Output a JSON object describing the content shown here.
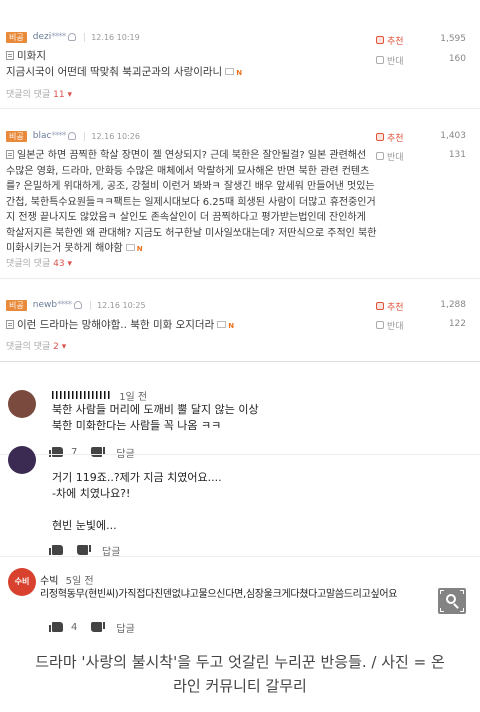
{
  "board": {
    "comments": [
      {
        "badge": "비공",
        "user": "dezi",
        "stars": "****",
        "time": "12.16 10:19",
        "text_lines": [
          "미화지",
          "지금시국이 어떤데 딱맞춰 북괴군과의 사랑이라니"
        ],
        "replies_label": "댓글의 댓글",
        "replies_count": "11",
        "up_label": "추천",
        "up_count": "1,595",
        "down_label": "반대",
        "down_count": "160"
      },
      {
        "badge": "비공",
        "user": "blac",
        "stars": "****",
        "time": "12.16 10:26",
        "text_lines": [
          "일본군 하면 끔찍한 학살 장면이 젤 연상되지? 근데 북한은 잘안될걸? 일본 관련해선",
          "수많은 영화, 드라마, 만화등 수많은 매체에서 악랄하게 묘사해온 반면 북한 관련 컨텐츠",
          "를? 은밀하게 위대하게, 공조, 강철비 이런거 봐봐ㅋ 잘생긴 배우 앞세워 만들어낸 멋있는",
          "간첩, 북한특수요원들ㅋㅋ팩트는 일제시대보다 6.25때 희생된 사람이 더많고 휴전중인거",
          "지 전쟁 끝나지도 않았음ㅋ 살인도 존속살인이 더 끔찍하다고 평가받는법인데 잔인하게",
          "학살저지른 북한엔 왜 관대해? 지금도 허구한날 미사일쏘대는데? 저딴식으로 주적인 북한",
          "미화시키는거 못하게 해야함"
        ],
        "replies_label": "댓글의 댓글",
        "replies_count": "43",
        "up_label": "추천",
        "up_count": "1,403",
        "down_label": "반대",
        "down_count": "131"
      },
      {
        "badge": "비공",
        "user": "newb",
        "stars": "****",
        "time": "12.16 10:25",
        "text_lines": [
          "이런 드라마는 망해야함.. 북한 미화 오지더라"
        ],
        "replies_label": "댓글의 댓글",
        "replies_count": "2",
        "up_label": "추천",
        "up_count": "1,288",
        "down_label": "반대",
        "down_count": "122"
      }
    ]
  },
  "community": {
    "comments": [
      {
        "avatar_color": "#7a4a3e",
        "avatar_text": "",
        "user": "",
        "time": "1일 전",
        "text_lines": [
          "북한 사람들 머리에 도깨비 뿔 달지 않는 이상",
          "북한 미화한다는 사람들 꼭 나옴 ㅋㅋ"
        ],
        "likes": "7",
        "reply_label": "답글"
      },
      {
        "avatar_color": "#3b2a52",
        "avatar_text": "",
        "user": "",
        "time": "",
        "text_lines": [
          "거기 119죠..?제가 지금 치였어요....",
          "-차에 치였나요?!",
          "",
          "현빈 눈빛에..."
        ],
        "likes": "",
        "reply_label": "답글"
      },
      {
        "avatar_color": "#d8412d",
        "avatar_text": "수비",
        "user": "수빅",
        "time": "5일 전",
        "text_lines": [
          "리정혁동무(현빈씨)가직접다친덴없냐고물으신다면,심장울크게다쳤다고말씀드리고싶어요"
        ],
        "likes": "4",
        "reply_label": "답글"
      }
    ]
  },
  "caption": {
    "line1": "드라마 '사랑의 불시착'을 두고 엇갈린 누리꾼 반응들. / 사진 = 온",
    "line2": "라인 커뮤니티 갈무리"
  }
}
